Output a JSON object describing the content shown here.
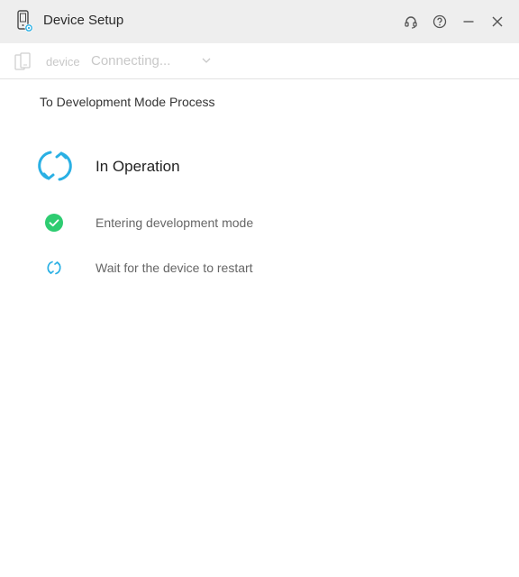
{
  "window": {
    "title": "Device Setup",
    "icons": {
      "support": "headset-icon",
      "help": "question-circle-icon",
      "minimize": "minimize-icon",
      "close": "close-icon"
    }
  },
  "device_bar": {
    "device_label": "device",
    "status": "Connecting...",
    "dropdown_icon": "chevron-down-icon"
  },
  "process": {
    "title": "To Development Mode Process",
    "status_heading": "In Operation",
    "steps": [
      {
        "label": "Entering development mode",
        "state": "done",
        "icon": "check-circle-icon"
      },
      {
        "label": "Wait for the device to restart",
        "state": "in-progress",
        "icon": "sync-icon"
      }
    ]
  },
  "colors": {
    "accent": "#2ab0e4",
    "success": "#2ecc71",
    "titlebar_bg": "#eeeeee",
    "disabled_text": "#c8c8c8"
  }
}
